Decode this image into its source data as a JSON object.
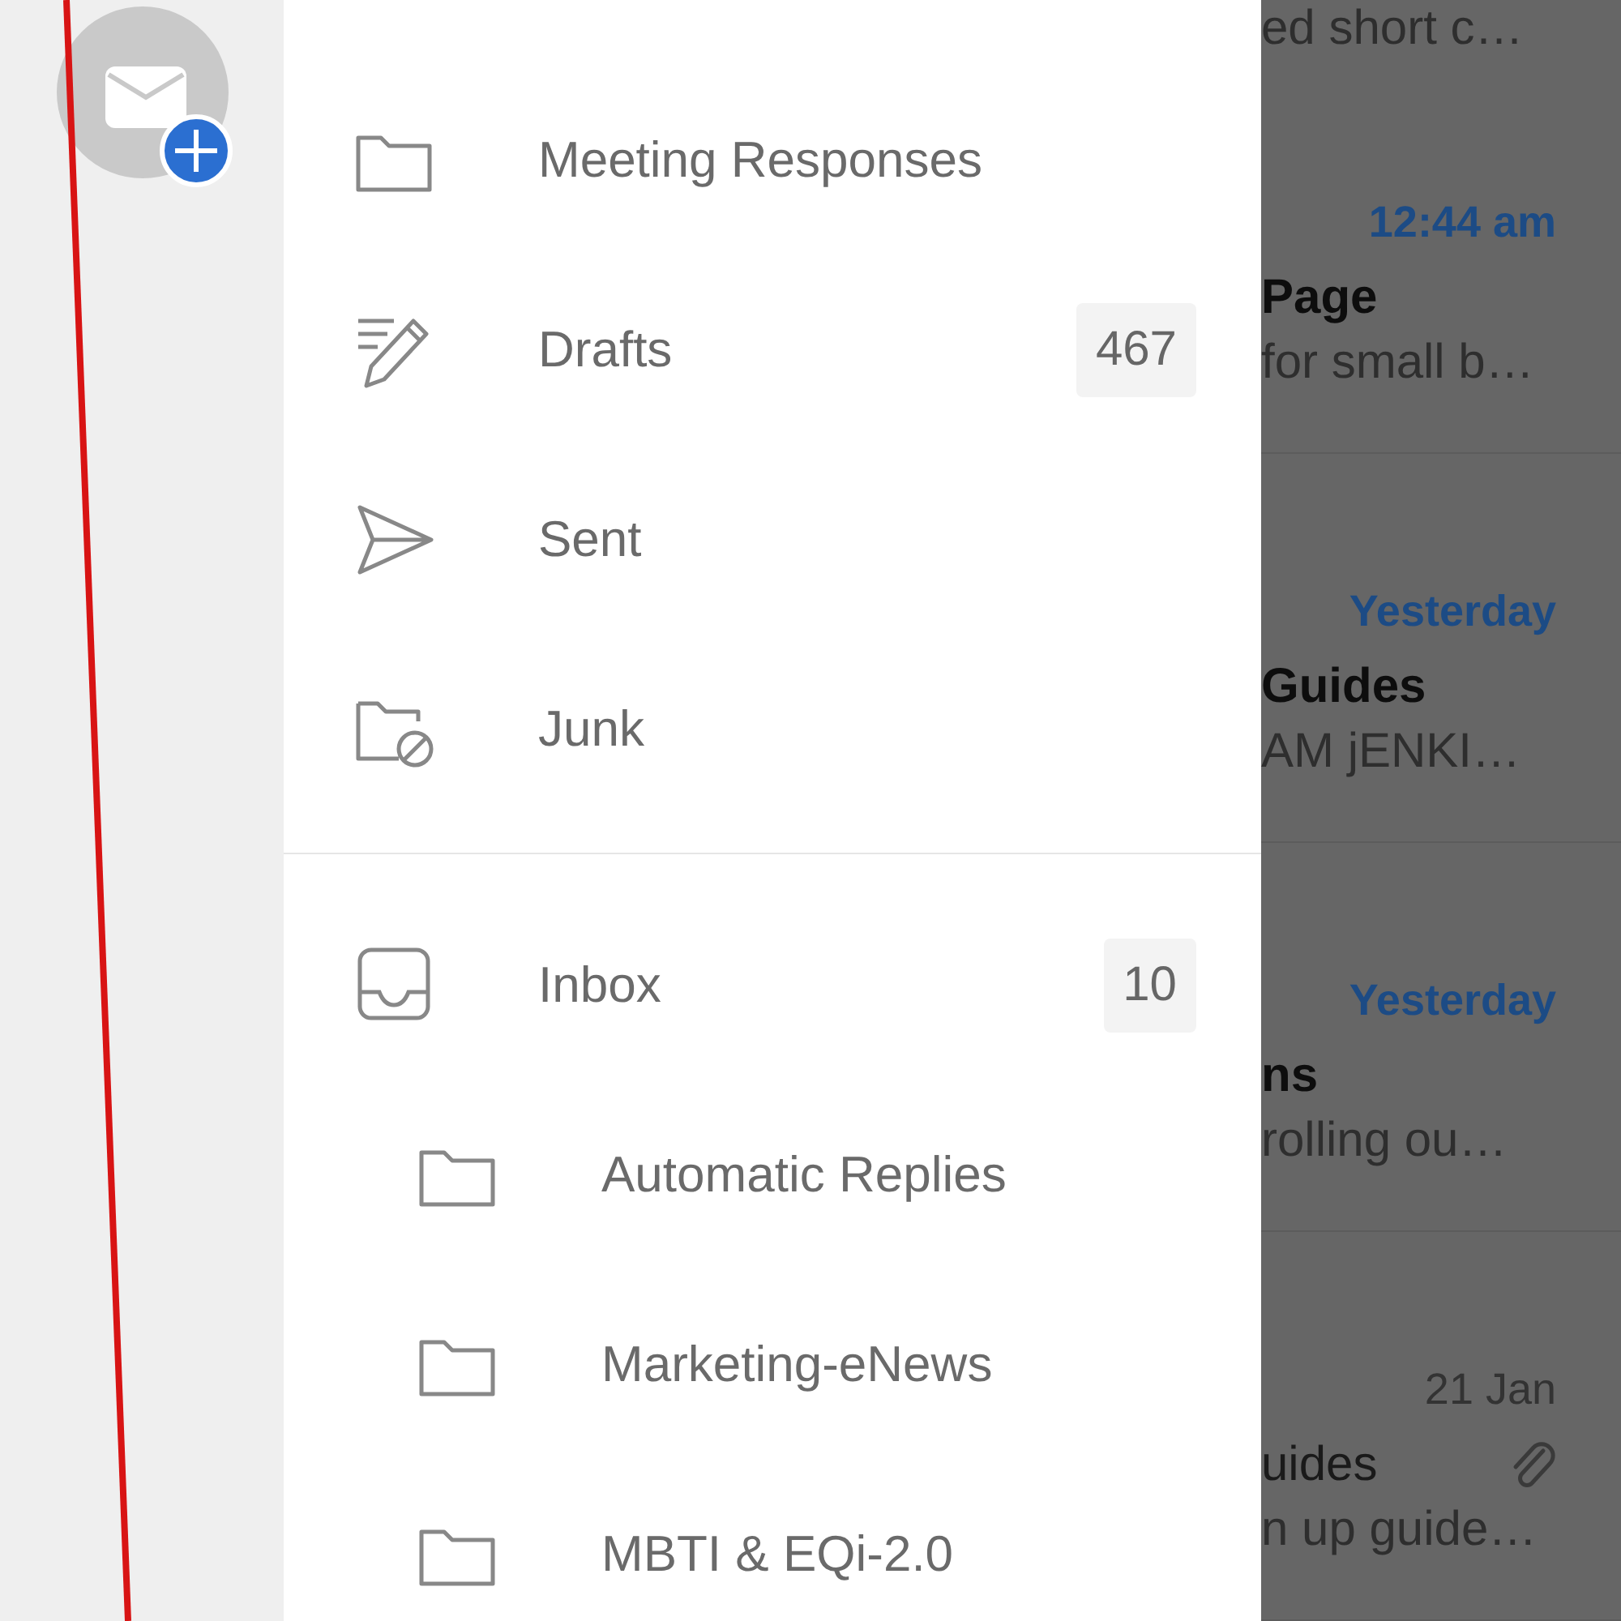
{
  "folder_groups": [
    {
      "folders": [
        {
          "kind": "folder",
          "name": "Meeting Responses"
        },
        {
          "kind": "drafts",
          "name": "Drafts",
          "count": "467"
        },
        {
          "kind": "sent",
          "name": "Sent"
        },
        {
          "kind": "junk",
          "name": "Junk"
        }
      ]
    },
    {
      "folders": [
        {
          "kind": "inbox",
          "name": "Inbox",
          "count": "10",
          "children": [
            {
              "kind": "folder",
              "name": "Automatic Replies"
            },
            {
              "kind": "folder",
              "name": "Marketing-eNews"
            },
            {
              "kind": "folder",
              "name": "MBTI & EQi-2.0"
            }
          ]
        }
      ]
    }
  ],
  "messages": [
    {
      "preview": "ed short c…"
    },
    {
      "time": "12:44 am",
      "sender": "Page",
      "preview": "for small b…",
      "unread": true
    },
    {
      "time": "Yesterday",
      "sender": "Guides",
      "preview": "AM jENKI…",
      "unread": true
    },
    {
      "time": "Yesterday",
      "sender": "ns",
      "preview": "rolling ou…",
      "unread": true
    },
    {
      "time": "21 Jan",
      "sender": "uides",
      "preview": "n up guide…",
      "unread": false,
      "attachment": true
    }
  ]
}
